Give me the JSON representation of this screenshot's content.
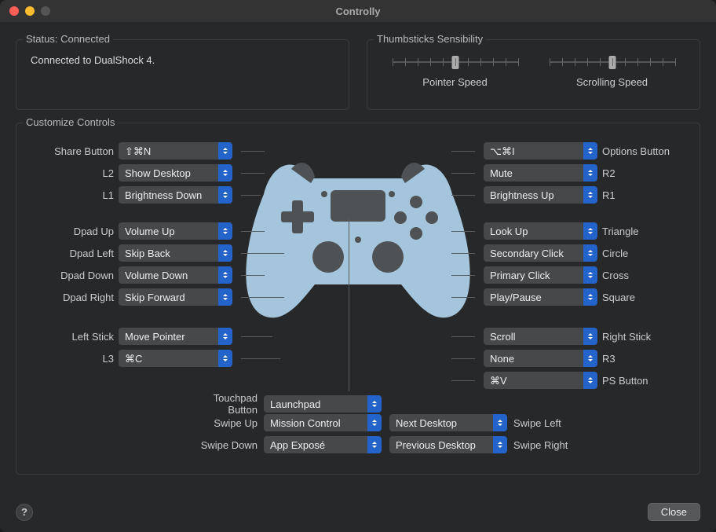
{
  "window_title": "Controlly",
  "status": {
    "label": "Status: Connected",
    "message": "Connected to DualShock 4."
  },
  "sensibility": {
    "label": "Thumbsticks Sensibility",
    "pointer_label": "Pointer Speed",
    "scrolling_label": "Scrolling Speed",
    "pointer_value_pct": 50,
    "scrolling_value_pct": 50
  },
  "customize_label": "Customize Controls",
  "left": [
    {
      "label": "Share Button",
      "value": "⇧⌘N"
    },
    {
      "label": "L2",
      "value": "Show Desktop"
    },
    {
      "label": "L1",
      "value": "Brightness Down"
    },
    {
      "label": "Dpad Up",
      "value": "Volume Up"
    },
    {
      "label": "Dpad Left",
      "value": "Skip Back"
    },
    {
      "label": "Dpad Down",
      "value": "Volume Down"
    },
    {
      "label": "Dpad Right",
      "value": "Skip Forward"
    },
    {
      "label": "Left Stick",
      "value": "Move Pointer"
    },
    {
      "label": "L3",
      "value": "⌘C"
    }
  ],
  "right": [
    {
      "label": "Options Button",
      "value": "⌥⌘I"
    },
    {
      "label": "R2",
      "value": "Mute"
    },
    {
      "label": "R1",
      "value": "Brightness Up"
    },
    {
      "label": "Triangle",
      "value": "Look Up"
    },
    {
      "label": "Circle",
      "value": "Secondary Click"
    },
    {
      "label": "Cross",
      "value": "Primary Click"
    },
    {
      "label": "Square",
      "value": "Play/Pause"
    },
    {
      "label": "Right Stick",
      "value": "Scroll"
    },
    {
      "label": "R3",
      "value": "None"
    },
    {
      "label": "PS Button",
      "value": "⌘V"
    }
  ],
  "bottom": {
    "touchpad": {
      "label": "Touchpad Button",
      "value": "Launchpad"
    },
    "swipe_up": {
      "label": "Swipe Up",
      "value": "Mission Control"
    },
    "swipe_down": {
      "label": "Swipe Down",
      "value": "App Exposé"
    },
    "swipe_left": {
      "label": "Swipe Left",
      "value": "Next Desktop"
    },
    "swipe_right": {
      "label": "Swipe Right",
      "value": "Previous Desktop"
    }
  },
  "help_glyph": "?",
  "close_label": "Close"
}
